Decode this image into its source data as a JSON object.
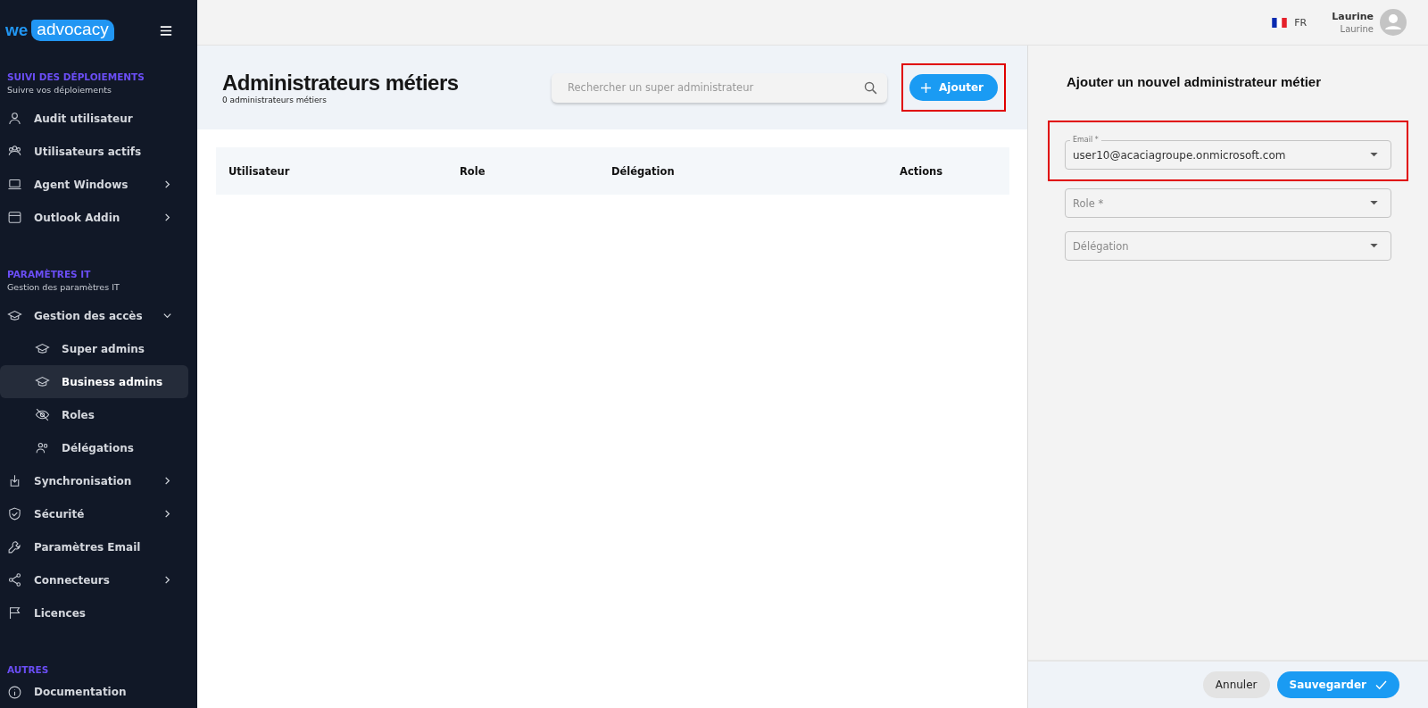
{
  "sidebar": {
    "logo": {
      "part_1": "we",
      "part_2": "advocacy"
    },
    "sections": [
      {
        "title": "SUIVI DES DÉPLOIEMENTS",
        "subtitle": "Suivre vos déploiements",
        "items": [
          {
            "label": "Audit utilisateur",
            "kind": "link",
            "selected": false
          },
          {
            "label": "Utilisateurs actifs",
            "kind": "link",
            "selected": false
          },
          {
            "label": "Agent Windows",
            "kind": "group",
            "expanded": false,
            "selected": false
          },
          {
            "label": "Outlook Addin",
            "kind": "group",
            "expanded": false,
            "selected": false
          }
        ]
      },
      {
        "title": "PARAMÈTRES IT",
        "subtitle": "Gestion des paramètres IT",
        "items": [
          {
            "label": "Gestion des accès",
            "kind": "group",
            "expanded": true,
            "selected": false,
            "children": [
              {
                "label": "Super admins",
                "selected": false
              },
              {
                "label": "Business admins",
                "selected": true
              },
              {
                "label": "Roles",
                "selected": false
              },
              {
                "label": "Délégations",
                "selected": false
              }
            ]
          },
          {
            "label": "Synchronisation",
            "kind": "group",
            "expanded": false,
            "selected": false
          },
          {
            "label": "Sécurité",
            "kind": "group",
            "expanded": false,
            "selected": false
          },
          {
            "label": "Paramètres Email",
            "kind": "link",
            "selected": false
          },
          {
            "label": "Connecteurs",
            "kind": "group",
            "expanded": false,
            "selected": false
          },
          {
            "label": "Licences",
            "kind": "link",
            "selected": false
          }
        ]
      },
      {
        "title": "AUTRES",
        "items": [
          {
            "label": "Documentation",
            "kind": "link",
            "selected": false
          }
        ]
      }
    ]
  },
  "topbar": {
    "language": "FR",
    "user": {
      "name": "Laurine",
      "subtitle": "Laurine"
    }
  },
  "page": {
    "title": "Administrateurs métiers",
    "subtitle": "0 administrateurs métiers",
    "search": {
      "placeholder": "Rechercher un super administrateur"
    },
    "add_button": {
      "label": "Ajouter",
      "highlighted": true
    },
    "table": {
      "columns": [
        "Utilisateur",
        "Role",
        "Délégation",
        "Actions"
      ]
    }
  },
  "panel": {
    "title": "Ajouter un nouvel administrateur métier",
    "fields": [
      {
        "label": "Email *",
        "value": "user10@acaciagroupe.onmicrosoft.com",
        "highlighted": true
      },
      {
        "placeholder": "Role *",
        "highlighted": false
      },
      {
        "placeholder": "Délégation",
        "highlighted": false
      }
    ],
    "cancel": "Annuler",
    "save": "Sauvegarder"
  }
}
